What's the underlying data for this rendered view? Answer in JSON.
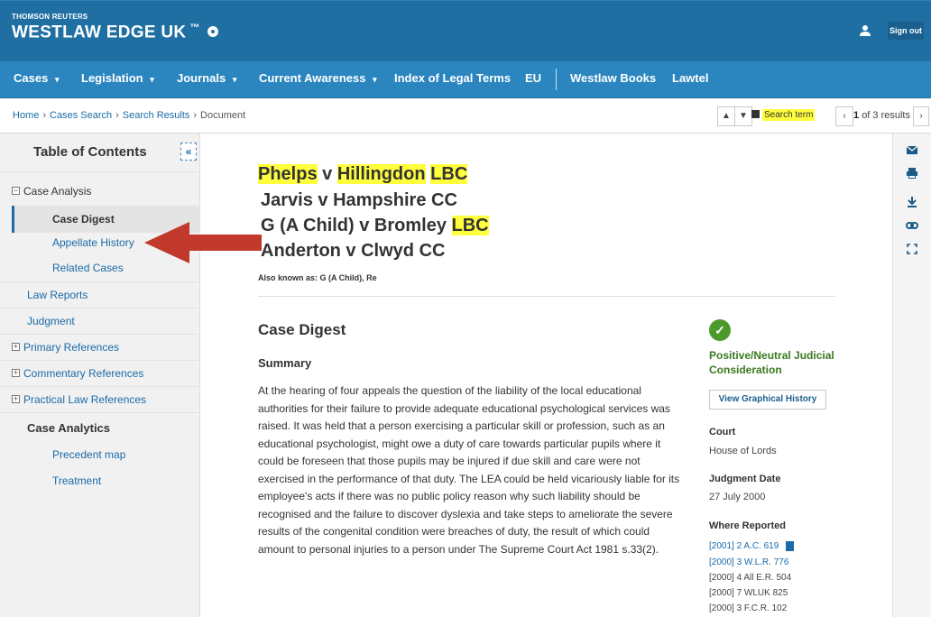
{
  "header": {
    "brand_small": "THOMSON REUTERS",
    "brand_big": "WESTLAW EDGE UK",
    "sign_out": "Sign out"
  },
  "nav": {
    "items": [
      "Cases",
      "Legislation",
      "Journals",
      "Current Awareness",
      "Index of Legal Terms",
      "EU",
      "Westlaw Books",
      "Lawtel"
    ],
    "dropdown_marker": "▾"
  },
  "breadcrumb": {
    "home": "Home",
    "cases_search": "Cases Search",
    "search_results": "Search Results",
    "document": "Document",
    "separator": "›"
  },
  "search": {
    "search_term_label": "Search term",
    "results_prefix": "1",
    "results_suffix": "of 3 results"
  },
  "toc": {
    "title": "Table of Contents",
    "collapse": "«",
    "case_analysis": "Case Analysis",
    "case_digest": "Case Digest",
    "appellate_history": "Appellate History",
    "related_cases": "Related Cases",
    "law_reports": "Law Reports",
    "judgment": "Judgment",
    "primary_references": "Primary References",
    "commentary_references": "Commentary References",
    "practical_law_references": "Practical Law References",
    "case_analytics": "Case Analytics",
    "precedent_map": "Precedent map",
    "treatment": "Treatment"
  },
  "document": {
    "title1_a": "Phelps",
    "title1_b": " v ",
    "title1_c": "Hillingdon",
    "title1_d": " ",
    "title1_e": "LBC",
    "title2": "Jarvis v Hampshire CC",
    "title3_a": "G (A Child) v Bromley ",
    "title3_b": "LBC",
    "title4": "Anderton v Clwyd CC",
    "aka": "Also known as: G (A Child), Re",
    "section_title": "Case Digest",
    "summary_heading": "Summary",
    "summary_text": "At the hearing of four appeals the question of the liability of the local educational authorities for their failure to provide adequate educational psychological services was raised. It was held that a person exercising a particular skill or profession, such as an educational psychologist, might owe a duty of care towards particular pupils where it could be foreseen that those pupils may be injured if due skill and care were not exercised in the performance of that duty. The LEA could be held vicariously liable for its employee's acts if there was no public policy reason why such liability should be recognised and the failure to discover dyslexia and take steps to ameliorate the severe results of the congenital condition were breaches of duty, the result of which could amount to personal injuries to a person under The Supreme Court Act 1981 s.33(2)."
  },
  "info": {
    "status_mark": "✓",
    "status_text": "Positive/Neutral Judicial Consideration",
    "graph_button": "View Graphical History",
    "court_label": "Court",
    "court_value": "House of Lords",
    "judgment_date_label": "Judgment Date",
    "judgment_date_value": "27 July 2000",
    "where_reported_label": "Where Reported",
    "reports": [
      "[2001] 2 A.C. 619",
      "[2000] 3 W.L.R. 776",
      "[2000] 4 All E.R. 504",
      "[2000] 7 WLUK 825",
      "[2000] 3 F.C.R. 102"
    ]
  },
  "colors": {
    "header_blue": "#1f6fa3",
    "nav_blue": "#2b86bf",
    "link_blue": "#1a6aa7",
    "highlight": "#ffff3d",
    "status_green": "#4d9a2c",
    "arrow_red": "#c0392b"
  },
  "icons": {
    "user": "user-icon",
    "email": "email-icon",
    "print": "print-icon",
    "download": "download-icon",
    "link": "link-icon",
    "fullscreen": "fullscreen-icon"
  }
}
